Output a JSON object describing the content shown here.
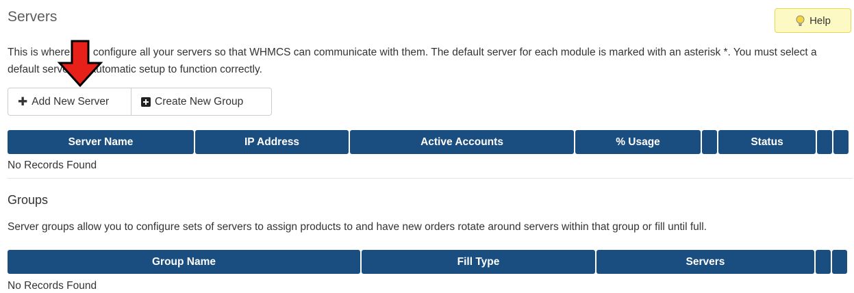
{
  "page": {
    "title": "Servers",
    "help_label": "Help",
    "intro_text": "This is where you configure all your servers so that WHMCS can communicate with them. The default server for each module is marked with an asterisk *. You must select a default server for automatic setup to function correctly."
  },
  "actions": {
    "add_server_label": "Add New Server",
    "create_group_label": "Create New Group"
  },
  "servers_table": {
    "columns": [
      "Server Name",
      "IP Address",
      "Active Accounts",
      "% Usage",
      "",
      "Status",
      "",
      ""
    ],
    "empty_text": "No Records Found"
  },
  "groups": {
    "title": "Groups",
    "description": "Server groups allow you to configure sets of servers to assign products to and have new orders rotate around servers within that group or fill until full."
  },
  "groups_table": {
    "columns": [
      "Group Name",
      "Fill Type",
      "Servers",
      "",
      ""
    ],
    "empty_text": "No Records Found"
  },
  "colors": {
    "header_bg": "#1a4d80",
    "help_bg": "#fdf9c4",
    "arrow": "#e8201a"
  },
  "icons": {
    "help": "lightbulb-icon",
    "add_server": "plus-icon",
    "create_group": "plus-square-icon",
    "annotation": "red-down-arrow"
  }
}
